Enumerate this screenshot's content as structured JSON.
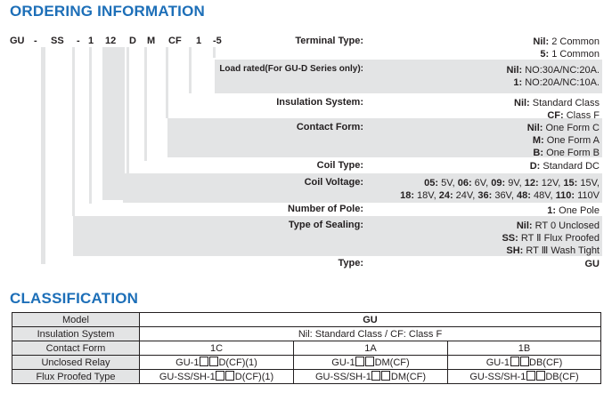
{
  "ordering": {
    "title": "ORDERING INFORMATION",
    "code_parts": [
      "GU",
      "-",
      "SS",
      "-",
      "1",
      "12",
      "D",
      "M",
      "CF",
      "1",
      "-5"
    ],
    "rows": [
      {
        "label": "Terminal Type:",
        "options": [
          {
            "key": "Nil:",
            "text": " 2 Common"
          },
          {
            "key": "5:",
            "text": " 1 Common"
          }
        ]
      },
      {
        "label": "Load rated(For GU-D Series only):",
        "options": [
          {
            "key": "Nil:",
            "text": " NO:30A/NC:20A."
          },
          {
            "key": "1:",
            "text": " NO:20A/NC:10A."
          }
        ]
      },
      {
        "label": "Insulation System:",
        "options": [
          {
            "key": "Nil:",
            "text": " Standard Class"
          },
          {
            "key": "CF:",
            "text": " Class  F"
          }
        ]
      },
      {
        "label": "Contact Form:",
        "options": [
          {
            "key": "Nil:",
            "text": " One Form C"
          },
          {
            "key": "M:",
            "text": " One Form A"
          },
          {
            "key": "B:",
            "text": " One Form B"
          }
        ]
      },
      {
        "label": "Coil Type:",
        "options": [
          {
            "key": "D:",
            "text": " Standard DC"
          }
        ]
      },
      {
        "label": "Coil Voltage:",
        "voltage_lines": [
          [
            {
              "key": "05:",
              "text": " 5V,  "
            },
            {
              "key": "06:",
              "text": " 6V,  "
            },
            {
              "key": "09:",
              "text": " 9V,  "
            },
            {
              "key": "12:",
              "text": " 12V,  "
            },
            {
              "key": "15:",
              "text": " 15V,"
            }
          ],
          [
            {
              "key": "18:",
              "text": " 18V, "
            },
            {
              "key": "24:",
              "text": " 24V, "
            },
            {
              "key": "36:",
              "text": " 36V, "
            },
            {
              "key": "48:",
              "text": " 48V, "
            },
            {
              "key": "110:",
              "text": " 110V"
            }
          ]
        ]
      },
      {
        "label": "Number of Pole:",
        "options": [
          {
            "key": "1:",
            "text": " One Pole"
          }
        ]
      },
      {
        "label": "Type of Sealing:",
        "options": [
          {
            "key": "Nil:",
            "text": " RT 0 Unclosed"
          },
          {
            "key": "SS:",
            "text": " RT Ⅱ  Flux Proofed"
          },
          {
            "key": "SH:",
            "text": " RT Ⅲ  Wash Tight"
          }
        ]
      },
      {
        "label": "Type:",
        "options": [
          {
            "key": "GU",
            "text": ""
          }
        ]
      }
    ]
  },
  "classification": {
    "title": "CLASSIFICATION",
    "model_label": "Model",
    "model_value": "GU",
    "insulation_label": "Insulation System",
    "insulation_value": "Nil: Standard Class / CF: Class F",
    "contact_label": "Contact Form",
    "contact_values": [
      "1C",
      "1A",
      "1B"
    ],
    "unclosed_label": "Unclosed Relay",
    "unclosed_values": [
      [
        "GU-1",
        "D(CF)(1)"
      ],
      [
        "GU-1",
        "DM(CF)"
      ],
      [
        "GU-1",
        "DB(CF)"
      ]
    ],
    "flux_label": "Flux Proofed Type",
    "flux_values": [
      [
        "GU-SS/SH-1",
        "D(CF)(1)"
      ],
      [
        "GU-SS/SH-1",
        "DM(CF)"
      ],
      [
        "GU-SS/SH-1",
        "DB(CF)"
      ]
    ]
  }
}
